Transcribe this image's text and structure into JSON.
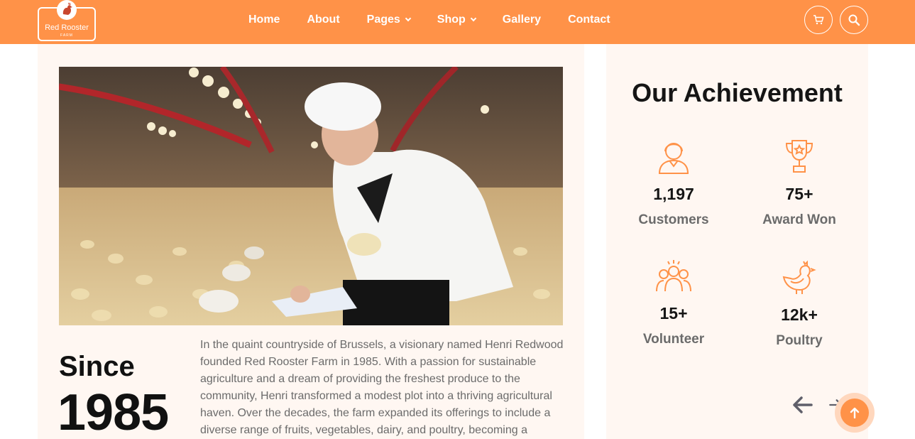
{
  "brand": {
    "name": "Red Rooster",
    "sub": "FARM",
    "accent": "#ff9248"
  },
  "nav": {
    "items": [
      {
        "label": "Home",
        "dropdown": false
      },
      {
        "label": "About",
        "dropdown": false
      },
      {
        "label": "Pages",
        "dropdown": true
      },
      {
        "label": "Shop",
        "dropdown": true
      },
      {
        "label": "Gallery",
        "dropdown": false
      },
      {
        "label": "Contact",
        "dropdown": false
      }
    ],
    "icons": [
      "cart-icon",
      "search-icon"
    ]
  },
  "about": {
    "since_label": "Since",
    "since_year": "1985",
    "story": "In the quaint countryside of Brussels, a visionary named Henri Redwood founded Red Rooster Farm in 1985. With a passion for sustainable agriculture and a dream of providing the freshest produce to the community, Henri transformed a modest plot into a thriving agricultural haven. Over the decades, the farm expanded its offerings to include a diverse range of fruits, vegetables, dairy, and poultry, becoming a"
  },
  "achievements": {
    "title": "Our Achievement",
    "stats": [
      {
        "icon": "customer-icon",
        "value": "1,197",
        "label": "Customers"
      },
      {
        "icon": "trophy-icon",
        "value": "75+",
        "label": "Award Won"
      },
      {
        "icon": "volunteer-icon",
        "value": "15+",
        "label": "Volunteer"
      },
      {
        "icon": "hen-icon",
        "value": "12k+",
        "label": "Poultry"
      }
    ]
  }
}
